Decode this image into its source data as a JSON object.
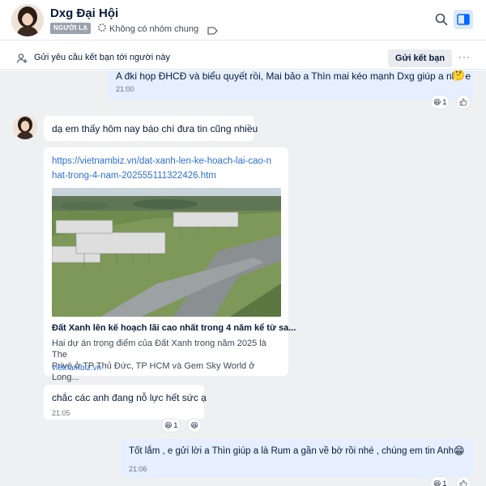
{
  "header": {
    "title": "Dxg Đại Hội",
    "stranger_badge": "NGƯỜI LẠ",
    "group_info": "Không có nhóm chung"
  },
  "friend_request": {
    "text": "Gửi yêu cầu kết bạn tới người này",
    "button": "Gửi kết bạn",
    "more": "···"
  },
  "messages": [
    {
      "id": "m1",
      "direction": "outgoing",
      "text": "A đki họp ĐHCĐ và biểu quyết rồi, Mai bảo a Thìn mai kéo mạnh Dxg giúp a nhé e",
      "emoji": "🤔",
      "time": "21:00",
      "reaction": {
        "emoji": "😆",
        "count": "1"
      }
    },
    {
      "id": "m2",
      "direction": "incoming",
      "text": "dạ em thấy hôm nay báo chí đưa tin cũng nhiều"
    },
    {
      "id": "m3",
      "direction": "incoming",
      "type": "link",
      "url_line1": "https://vietnambiz.vn/dat-xanh-len-ke-hoach-lai-cao-n",
      "url_line2": "hat-trong-4-nam-202555111322426.htm",
      "title": "Đất Xanh lên kế hoạch lãi cao nhất trong 4 năm kể từ sa...",
      "desc_line1": "Hai dự án trọng điểm của Đất Xanh trong năm 2025 là The",
      "desc_line2": "Privé ở TP Thủ Đức, TP HCM và Gem Sky World ở Long...",
      "domain": "vietnambiz.vn"
    },
    {
      "id": "m4",
      "direction": "incoming",
      "text": "chắc các anh đang nỗ lực hết sức ạ",
      "time": "21:05",
      "reaction": {
        "emoji": "😆",
        "count": "1",
        "emoji2": "😆"
      }
    },
    {
      "id": "m5",
      "direction": "outgoing",
      "text": "Tốt lắm , e gửi lời a  Thìn giúp a  là Rum a gần về bờ rồi nhé , chúng em tin Anh",
      "emoji": "😁",
      "time": "21:06",
      "reaction": {
        "emoji": "😆",
        "count": "1"
      }
    }
  ],
  "colors": {
    "outgoing_bubble": "#e5efff",
    "incoming_bubble": "#ffffff",
    "chat_bg": "#eef0f2",
    "link": "#2d6fd2"
  }
}
